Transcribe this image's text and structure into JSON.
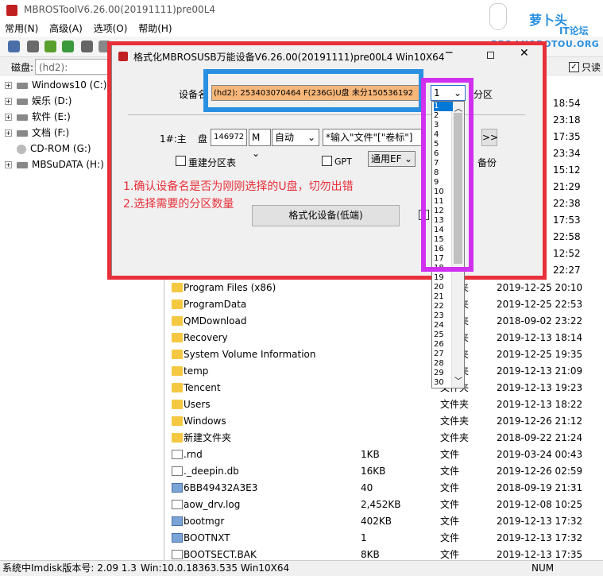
{
  "window": {
    "title": "MBROSToolV6.26.00(20191111)pre00L4"
  },
  "menu": [
    "常用(N)",
    "高级(A)",
    "选项(O)",
    "帮助(H)"
  ],
  "diskbar": {
    "label": "磁盘:",
    "disk_value": "(hd2): F(236G)",
    "readonly_label": "只读"
  },
  "tree": [
    {
      "label": "Windows10 (C:)"
    },
    {
      "label": "娱乐 (D:)"
    },
    {
      "label": "软件 (E:)"
    },
    {
      "label": "文档 (F:)"
    },
    {
      "label": "CD-ROM (G:)"
    },
    {
      "label": "MBSuDATA (H:)"
    }
  ],
  "files": [
    {
      "name": "Program Files (x86)",
      "size": "",
      "type": "文件夹",
      "date": "2019-12-25 20:10",
      "icon": "folder"
    },
    {
      "name": "ProgramData",
      "size": "",
      "type": "文件夹",
      "date": "2019-12-25 22:53",
      "icon": "folder"
    },
    {
      "name": "QMDownload",
      "size": "",
      "type": "文件夹",
      "date": "2018-09-02 23:22",
      "icon": "folder"
    },
    {
      "name": "Recovery",
      "size": "",
      "type": "文件夹",
      "date": "2019-12-13 18:14",
      "icon": "folder"
    },
    {
      "name": "System Volume Information",
      "size": "",
      "type": "文件夹",
      "date": "2019-12-25 19:35",
      "icon": "folder"
    },
    {
      "name": "temp",
      "size": "",
      "type": "文件夹",
      "date": "2019-12-13 21:09",
      "icon": "folder"
    },
    {
      "name": "Tencent",
      "size": "",
      "type": "文件夹",
      "date": "2019-12-13 19:23",
      "icon": "folder"
    },
    {
      "name": "Users",
      "size": "",
      "type": "文件夹",
      "date": "2019-12-13 18:22",
      "icon": "folder"
    },
    {
      "name": "Windows",
      "size": "",
      "type": "文件夹",
      "date": "2019-12-26 21:12",
      "icon": "folder"
    },
    {
      "name": "新建文件夹",
      "size": "",
      "type": "文件夹",
      "date": "2018-09-22 21:24",
      "icon": "folder"
    },
    {
      "name": ".rnd",
      "size": "1KB",
      "type": "文件",
      "date": "2019-03-24 00:43",
      "icon": "file"
    },
    {
      "name": "._deepin.db",
      "size": "16KB",
      "type": "文件",
      "date": "2019-12-26 02:59",
      "icon": "file"
    },
    {
      "name": "6BB49432A3E3",
      "size": "40",
      "type": "文件",
      "date": "2018-09-19 21:31",
      "icon": "sys"
    },
    {
      "name": "aow_drv.log",
      "size": "2,452KB",
      "type": "文件",
      "date": "2019-12-08 10:25",
      "icon": "file"
    },
    {
      "name": "bootmgr",
      "size": "402KB",
      "type": "文件",
      "date": "2019-12-13 17:32",
      "icon": "sys"
    },
    {
      "name": "BOOTNXT",
      "size": "1",
      "type": "文件",
      "date": "2019-12-13 17:32",
      "icon": "sys"
    },
    {
      "name": "BOOTSECT.BAK",
      "size": "8KB",
      "type": "文件",
      "date": "2019-12-13 17:35",
      "icon": "file"
    }
  ],
  "hidden_dates": [
    "18:54",
    "23:18",
    "17:35",
    "23:34",
    "15:12",
    "21:29",
    "22:38",
    "17:53",
    "22:58",
    "12:52",
    "22:27"
  ],
  "status": {
    "left": "系统中Imdisk版本号: 2.09 1.3",
    "mid": "Win:10.0.18363.535 Win10X64",
    "right": "NUM"
  },
  "dialog": {
    "title": "格式化MBROSUSB万能设备V6.26.00(20191111)pre00L4 Win10X64",
    "device_label": "设备名",
    "device_value": "(hd2): 253403070464 F(236G)U盘 未分150536192",
    "partition_count": "1",
    "partition_suffix": "分区",
    "row1_label": "1#:主",
    "disk_label": "盘",
    "size_value": "146972",
    "unit": "M",
    "fs": "自动",
    "volume_hint": "*输入\"文件\"[\"卷标\"]",
    "next_btn": ">>",
    "rebuild_label": "重建分区表",
    "gpt_label": "GPT",
    "ef_value": "通用EF",
    "backup_label": "备份",
    "format_button": "格式化设备(低端)"
  },
  "notes": {
    "line1": "1.确认设备名是否为刚刚选择的U盘，切勿出错",
    "line2": "2.选择需要的分区数量"
  },
  "dropdown_options": [
    "1",
    "2",
    "3",
    "4",
    "5",
    "6",
    "7",
    "8",
    "9",
    "10",
    "11",
    "12",
    "13",
    "14",
    "15",
    "16",
    "17",
    "18",
    "19",
    "20",
    "21",
    "22",
    "23",
    "24",
    "25",
    "26",
    "27",
    "28",
    "29",
    "30"
  ],
  "logo": {
    "text1": "萝卜头",
    "text2": "IT论坛",
    "url": "BBS.LUOBOTOU.ORG"
  },
  "colors": {
    "annotation_red": "#e8303a",
    "highlight_blue": "#2a8fe0",
    "highlight_purple": "#d030f0",
    "device_field_bg": "#f7b77a"
  }
}
